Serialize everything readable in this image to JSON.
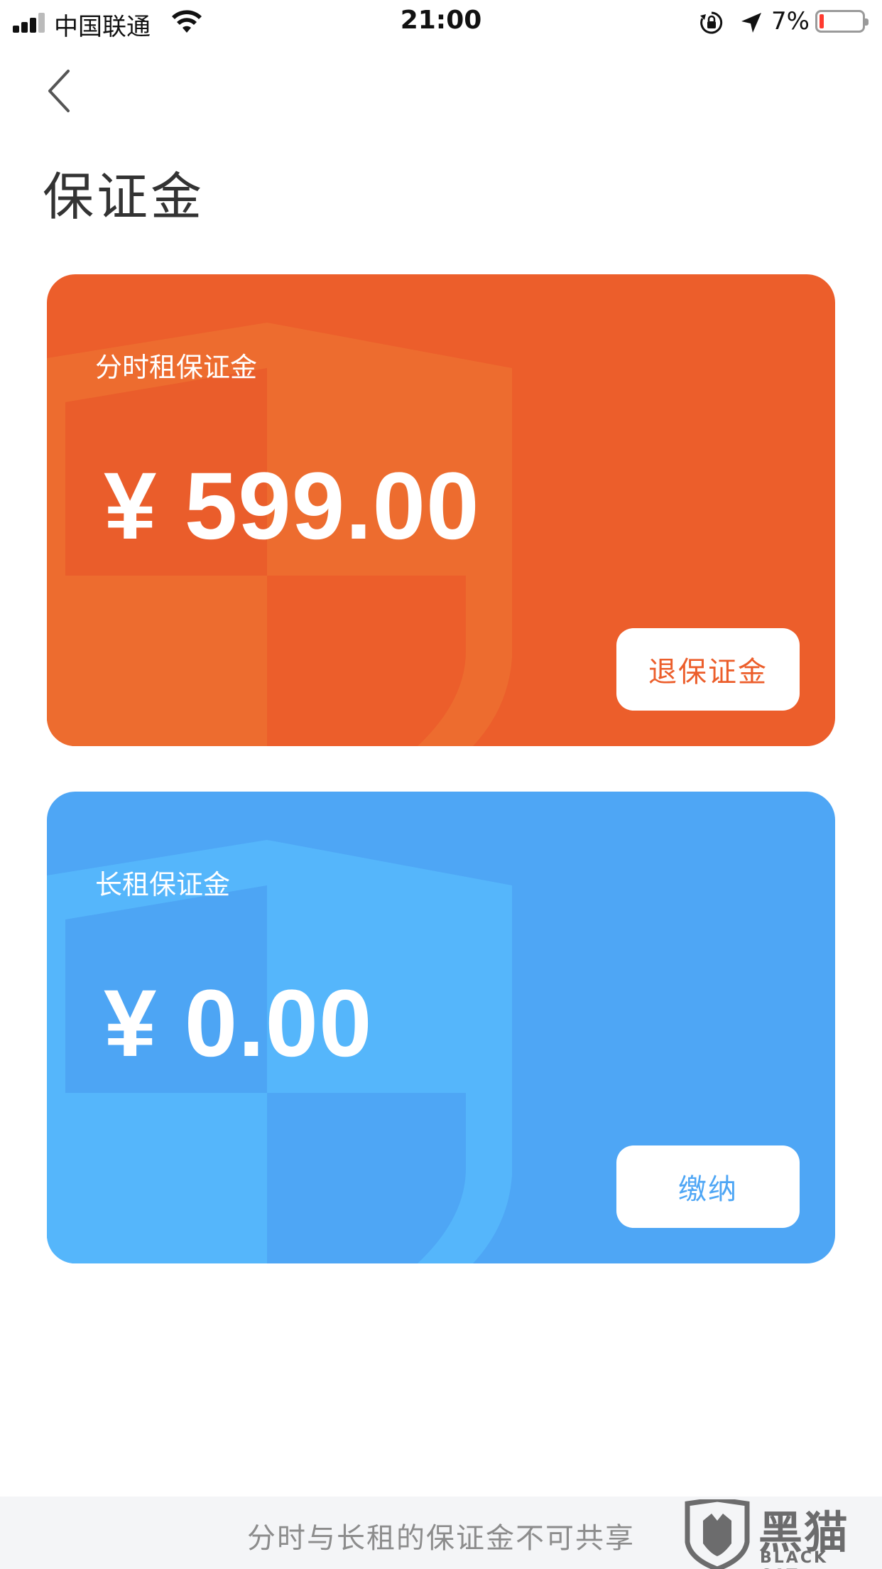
{
  "status_bar": {
    "carrier": "中国联通",
    "time": "21:00",
    "battery_percent": "7%",
    "icons": [
      "signal-icon",
      "wifi-icon",
      "rotation-lock-icon",
      "location-arrow-icon",
      "battery-icon"
    ]
  },
  "nav": {
    "back_icon": "chevron-left-icon"
  },
  "page": {
    "title": "保证金"
  },
  "cards": [
    {
      "label": "分时租保证金",
      "amount": "¥ 599.00",
      "button_label": "退保证金",
      "color": "#ec5e2b"
    },
    {
      "label": "长租保证金",
      "amount": "¥ 0.00",
      "button_label": "缴纳",
      "color": "#4ea6f5"
    }
  ],
  "footer": {
    "note": "分时与长租的保证金不可共享"
  },
  "watermark": {
    "text": "黑猫",
    "subtext": "BLACK CAT"
  }
}
